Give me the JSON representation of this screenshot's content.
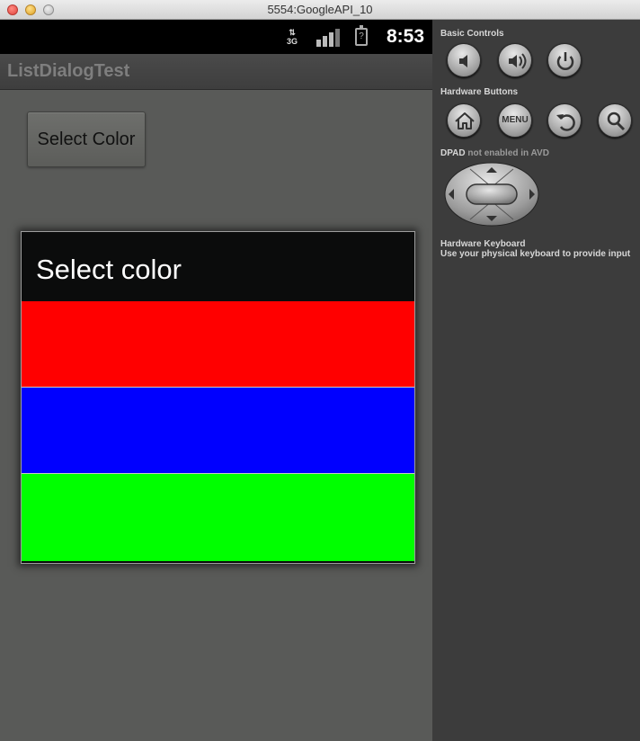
{
  "window": {
    "title": "5554:GoogleAPI_10"
  },
  "status_bar": {
    "network": "3G",
    "battery": "?",
    "time": "8:53"
  },
  "app": {
    "title": "ListDialogTest",
    "button_label": "Select Color"
  },
  "dialog": {
    "title": "Select color",
    "items": [
      {
        "name": "red",
        "color": "#ff0000"
      },
      {
        "name": "blue",
        "color": "#0000ff"
      },
      {
        "name": "green",
        "color": "#00ff00"
      }
    ]
  },
  "panel": {
    "basic_controls": "Basic Controls",
    "hardware_buttons": "Hardware Buttons",
    "menu_label": "MENU",
    "dpad_label": "DPAD",
    "dpad_note": "not enabled in AVD",
    "keyboard_title": "Hardware Keyboard",
    "keyboard_note": "Use your physical keyboard to provide input",
    "icons": [
      "volume-down-icon",
      "volume-up-icon",
      "power-icon",
      "home-icon",
      "menu-icon",
      "back-icon",
      "search-icon",
      "dpad-icon"
    ]
  }
}
